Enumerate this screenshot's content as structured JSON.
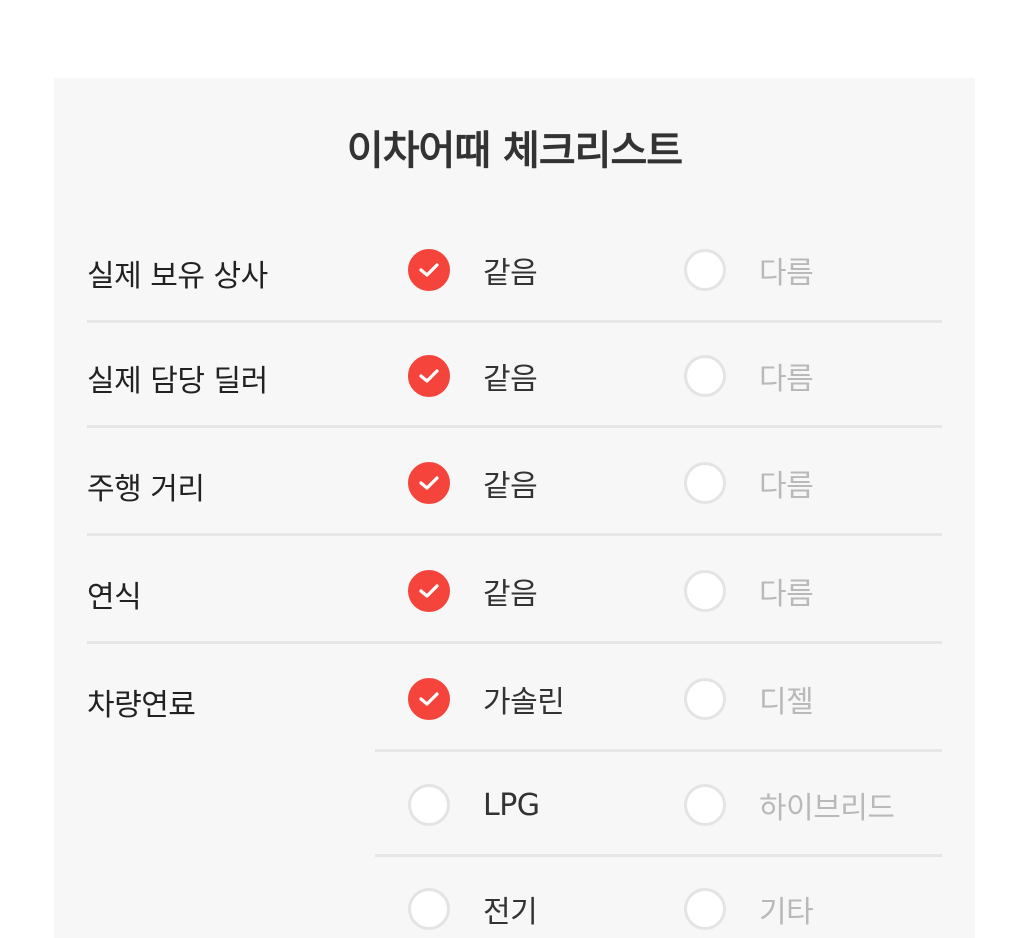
{
  "title": "이차어때 체크리스트",
  "rows": [
    {
      "label": "실제 보유 상사",
      "opt1": "같음",
      "opt2": "다름"
    },
    {
      "label": "실제 담당 딜러",
      "opt1": "같음",
      "opt2": "다름"
    },
    {
      "label": "주행 거리",
      "opt1": "같음",
      "opt2": "다름"
    },
    {
      "label": "연식",
      "opt1": "같음",
      "opt2": "다름"
    },
    {
      "label": "차량연료",
      "opt1": "가솔린",
      "opt2": "디젤"
    }
  ],
  "fuel_extra": [
    {
      "opt1": "LPG",
      "opt2": "하이브리드"
    },
    {
      "opt1": "전기",
      "opt2": "기타"
    }
  ],
  "colors": {
    "accent": "#f4443c",
    "card_bg": "#f7f7f7",
    "divider": "#e6e6e6",
    "muted_text": "#b9b9b9"
  },
  "icons": {
    "checked": "check-icon"
  }
}
